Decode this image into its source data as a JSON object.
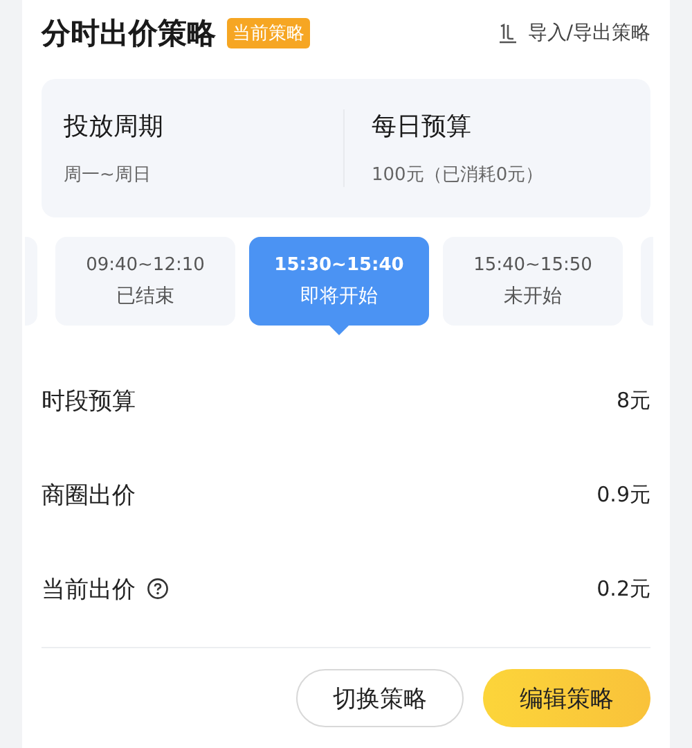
{
  "header": {
    "title": "分时出价策略",
    "badge": "当前策略",
    "import_export": "导入/导出策略"
  },
  "summary": [
    {
      "label": "投放周期",
      "value": "周一~周日"
    },
    {
      "label": "每日预算",
      "value": "100元（已消耗0元）"
    }
  ],
  "time_slots": [
    {
      "time": "09:40~12:10",
      "status": "已结束",
      "selected": false
    },
    {
      "time": "15:30~15:40",
      "status": "即将开始",
      "selected": true
    },
    {
      "time": "15:40~15:50",
      "status": "未开始",
      "selected": false
    }
  ],
  "details": [
    {
      "label": "时段预算",
      "value": "8元",
      "help": false
    },
    {
      "label": "商圈出价",
      "value": "0.9元",
      "help": false
    },
    {
      "label": "当前出价",
      "value": "0.2元",
      "help": true
    }
  ],
  "buttons": [
    {
      "label": "切换策略",
      "kind": "secondary"
    },
    {
      "label": "编辑策略",
      "kind": "primary"
    }
  ]
}
